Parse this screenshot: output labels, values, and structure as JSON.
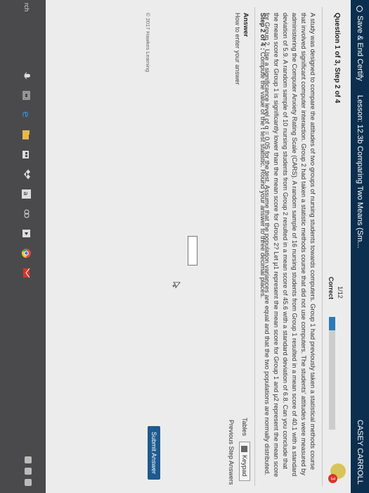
{
  "topbar": {
    "save_label": "Save & End Certify",
    "lesson": "Lesson: 12.3b Comparing Two Means (Sm...",
    "user": "CASEY CARROLL"
  },
  "question": {
    "header": "Question 1 of 3, Step 2 of 4",
    "score": "1/12",
    "status": "Correct",
    "progress_fraction": 0.12,
    "badge_count": "3"
  },
  "problem_text": "A study was designed to compare the attitudes of two groups of nursing students towards computers. Group 1 had previously taken a statistical methods course that involved significant computer interaction. Group 2 had taken a statistic methods course that did not use computers. The students' attitudes were measured by administering the Computer Anxiety Rating Scale (CARS). A random sample of 16 nursing students from Group 1 resulted in a mean score of 40.1 with a standard deviation of 5.9. A random sample of 10 nursing students from Group 2 resulted in a mean score of 45.6 with a standard deviation of 6.8. Can you conclude that the mean score for Group 1 is significantly lower than the mean score for Group 2? Let μ1 represent the mean score for Group 1 and μ2 represent the mean score for Group 2. Use a significance level of α = 0.05 for the test. Assume that the population variances are equal and that the two populations are normally distributed.",
  "step": {
    "label": "Step 2 of 4 :",
    "text": "Compute the value of the t test statistic. Round your answer to three decimal places."
  },
  "answer": {
    "title": "Answer",
    "hint": "How to enter your answer",
    "tables": "Tables",
    "keypad": "Keypad",
    "previous": "Previous Step Answers",
    "submit": "Submit Answer"
  },
  "footer": "© 2017 Hawkes Learning",
  "taskbar": {
    "search_label": "rch",
    "icons": [
      "microphone-icon",
      "task-view-icon",
      "edge-icon",
      "file-explorer-icon",
      "store-icon",
      "dropbox-icon",
      "amazon-icon",
      "people-icon",
      "media-icon",
      "chrome-icon",
      "mail-icon"
    ]
  },
  "colors": {
    "topbar": "#0c2f4f",
    "progress": "#2a7ab8",
    "submit": "#1e5a8e",
    "badge": "#d9342b"
  }
}
